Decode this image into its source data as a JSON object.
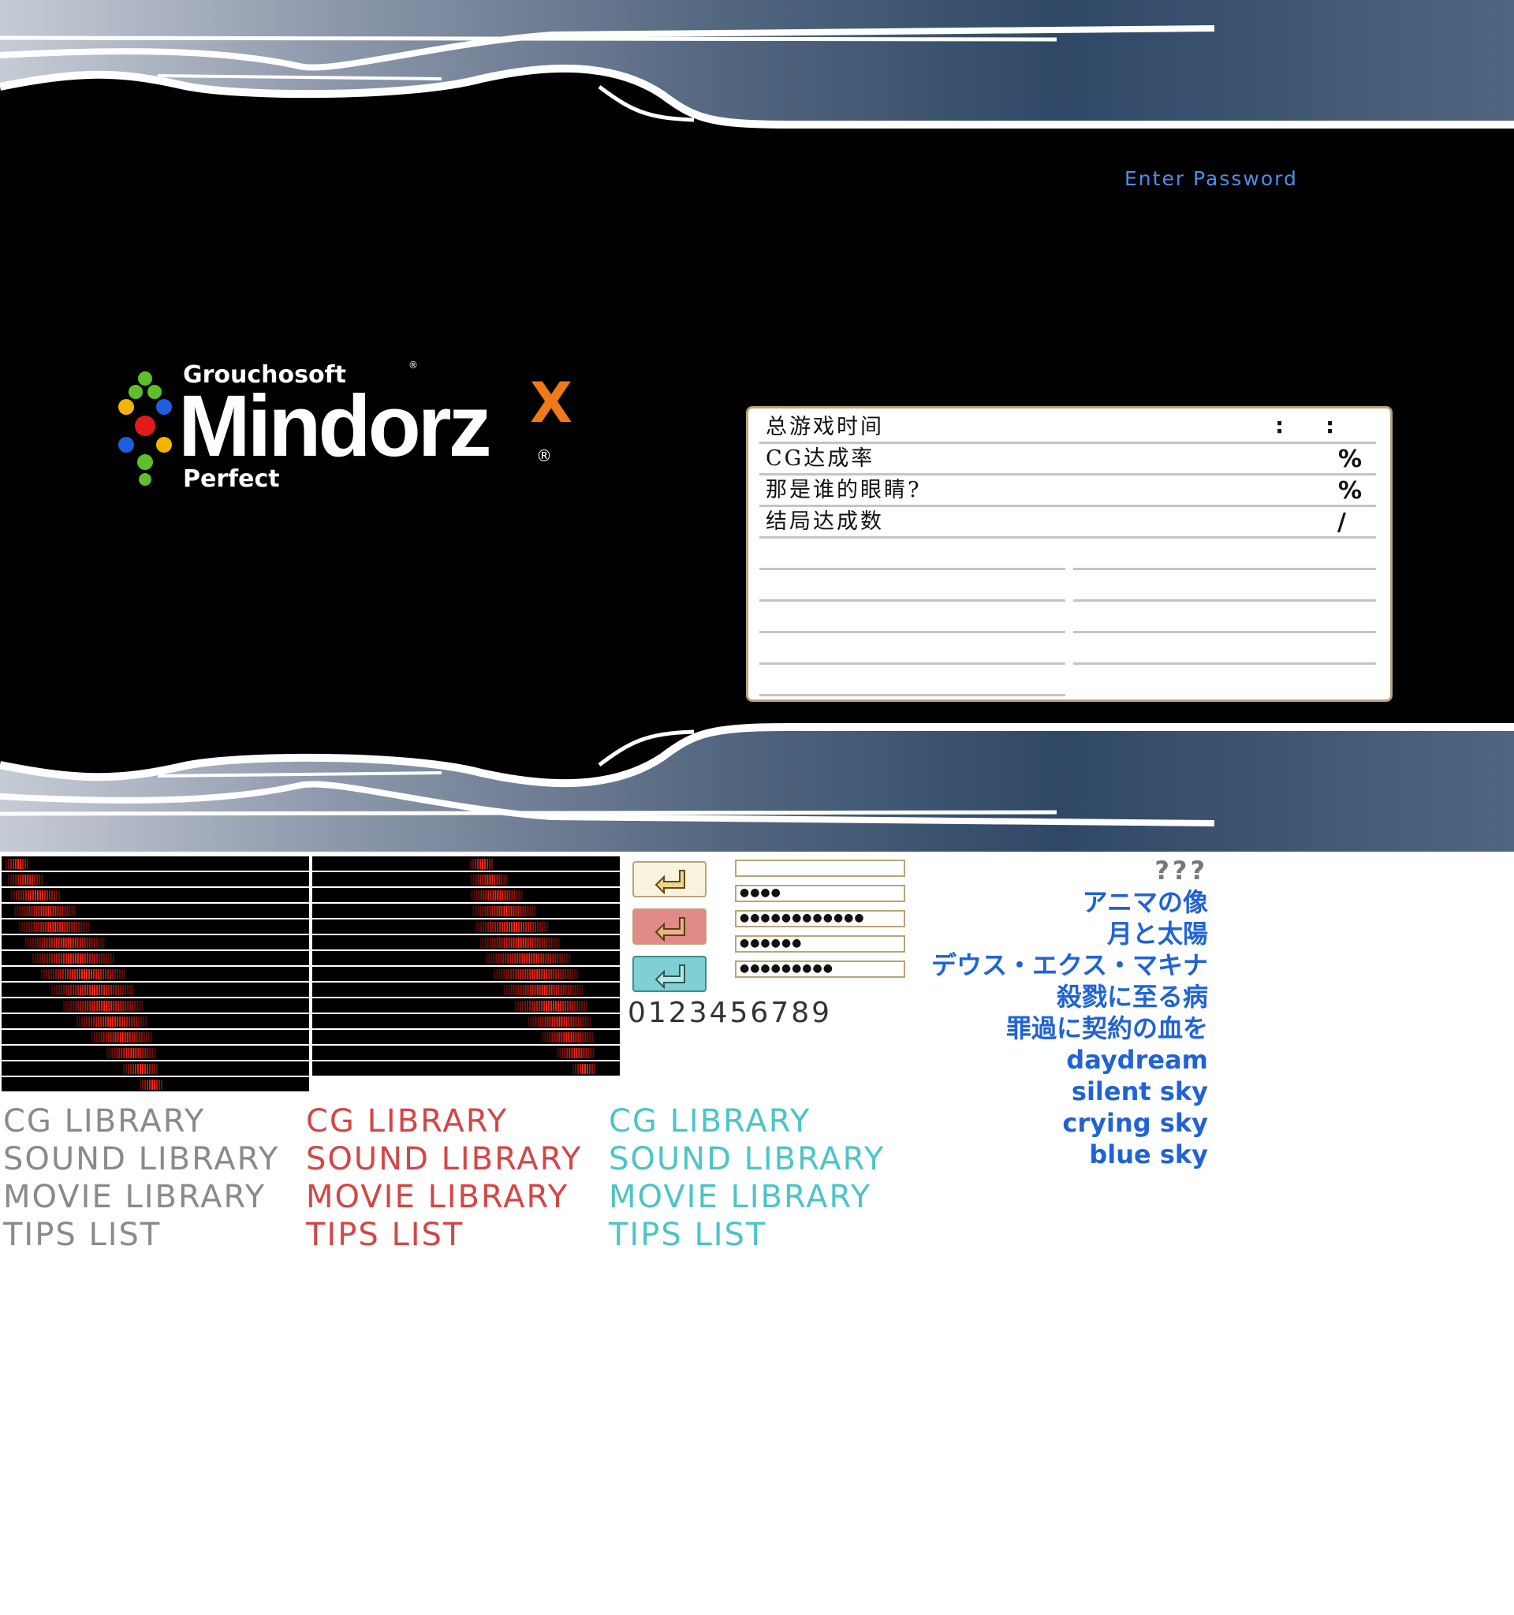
{
  "title_screen": {
    "enter_password": "Enter Password",
    "logo": {
      "publisher": "Grouchosoft",
      "publisher_mark": "®",
      "title": "Mindorz",
      "title_mark": "X",
      "registered": "®",
      "edition": "Perfect"
    },
    "stats": [
      {
        "label": "总游戏时间",
        "suffix": ":   :"
      },
      {
        "label": "CG达成率",
        "suffix": "%"
      },
      {
        "label": "那是谁的眼睛?",
        "suffix": "%"
      },
      {
        "label": "结局达成数",
        "suffix": "/"
      }
    ]
  },
  "enter_buttons": [
    {
      "state": "normal",
      "color": "#f8f3dc"
    },
    {
      "state": "hover",
      "color": "#e08b87"
    },
    {
      "state": "active",
      "color": "#7fd0d2"
    }
  ],
  "password_fields": [
    "",
    "●●●●",
    "●●●●●●●●●●●●",
    "●●●●●●",
    "●●●●●●●●●"
  ],
  "digits": "0123456789",
  "libraries": {
    "items": [
      "CG LIBRARY",
      "SOUND LIBRARY",
      "MOVIE LIBRARY",
      "TIPS LIST"
    ],
    "colors": {
      "normal": "#8a8a8a",
      "hover": "#d54545",
      "active": "#4cc4c8"
    }
  },
  "songs": [
    "???",
    "アニマの像",
    "月と太陽",
    "デウス・エクス・マキナ",
    "殺戮に至る病",
    "罪過に契約の血を",
    "daydream",
    "silent sky",
    "crying sky",
    "blue sky"
  ]
}
